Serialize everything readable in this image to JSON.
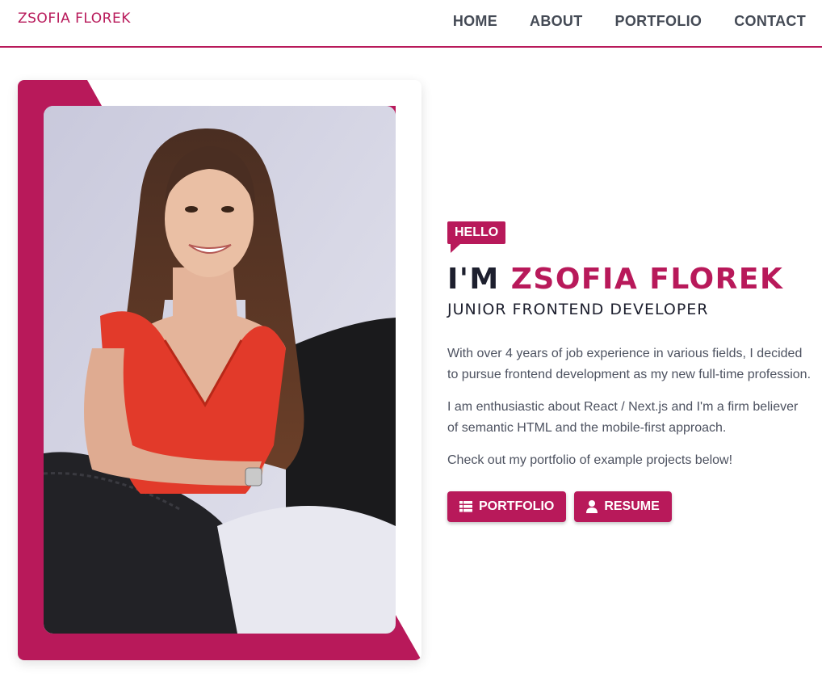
{
  "brand": "ZSOFIA FLOREK",
  "nav": {
    "items": [
      "HOME",
      "ABOUT",
      "PORTFOLIO",
      "CONTACT"
    ]
  },
  "hero": {
    "badge": "HELLO",
    "title_prefix": "I'M ",
    "title_name": "ZSOFIA FLOREK",
    "subtitle": "JUNIOR FRONTEND DEVELOPER",
    "paragraphs": [
      "With over 4 years of job experience in various fields, I decided to pursue frontend development as my new full-time profession.",
      "I am enthusiastic about React / Next.js and I'm a firm believer of semantic HTML and the mobile-first approach.",
      "Check out my portfolio of example projects below!"
    ],
    "buttons": {
      "portfolio": {
        "label": "PORTFOLIO",
        "icon": "grid-list-icon"
      },
      "resume": {
        "label": "RESUME",
        "icon": "user-icon"
      }
    }
  },
  "colors": {
    "accent": "#b8195a",
    "text_dark": "#1d1f2e",
    "text_body": "#4d5260"
  }
}
